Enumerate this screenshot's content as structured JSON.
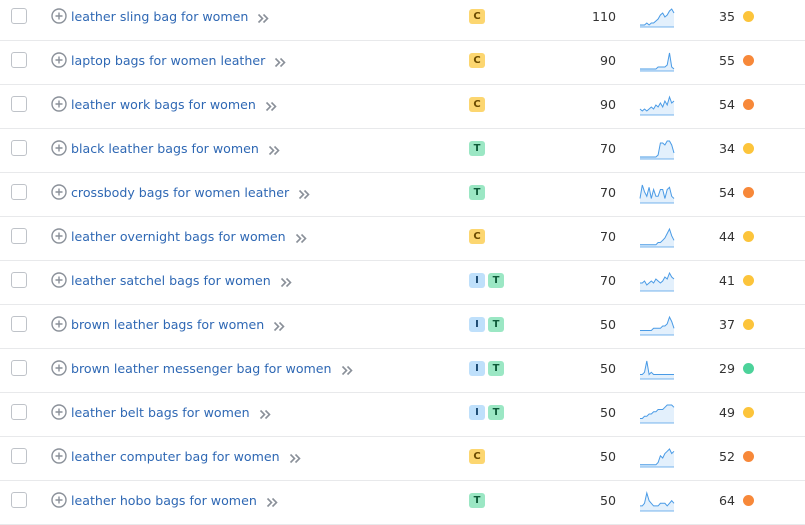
{
  "colors": {
    "link": "#2f68b4",
    "kd_easy": "#4cd29a",
    "kd_possible": "#fcc43b",
    "kd_difficult": "#f78839",
    "trend_line": "#4a9be6",
    "trend_fill": "#e3f0fc"
  },
  "rows": [
    {
      "keyword": "leather sling bag for women",
      "intents": [
        "C"
      ],
      "volume": "110",
      "trend": [
        1,
        1,
        1,
        2,
        1,
        2,
        2,
        3,
        4,
        6,
        7,
        5,
        6,
        8,
        9,
        7
      ],
      "kd": "35",
      "kd_level": "possible"
    },
    {
      "keyword": "laptop bags for women leather",
      "intents": [
        "C"
      ],
      "volume": "90",
      "trend": [
        1,
        1,
        1,
        1,
        1,
        1,
        1,
        1,
        2,
        2,
        2,
        2,
        3,
        9,
        2,
        1
      ],
      "kd": "55",
      "kd_level": "difficult"
    },
    {
      "keyword": "leather work bags for women",
      "intents": [
        "C"
      ],
      "volume": "90",
      "trend": [
        3,
        2,
        3,
        2,
        3,
        4,
        3,
        5,
        4,
        6,
        4,
        7,
        5,
        9,
        6,
        7
      ],
      "kd": "54",
      "kd_level": "difficult"
    },
    {
      "keyword": "black leather bags for women",
      "intents": [
        "T"
      ],
      "volume": "70",
      "trend": [
        1,
        1,
        1,
        1,
        1,
        1,
        1,
        1,
        2,
        8,
        8,
        7,
        9,
        9,
        7,
        3
      ],
      "kd": "34",
      "kd_level": "possible"
    },
    {
      "keyword": "crossbody bags for women leather",
      "intents": [
        "T"
      ],
      "volume": "70",
      "trend": [
        2,
        8,
        5,
        3,
        7,
        2,
        6,
        3,
        3,
        6,
        6,
        2,
        6,
        7,
        3,
        2
      ],
      "kd": "54",
      "kd_level": "difficult"
    },
    {
      "keyword": "leather overnight bags for women",
      "intents": [
        "C"
      ],
      "volume": "70",
      "trend": [
        1,
        1,
        1,
        1,
        1,
        1,
        1,
        1,
        2,
        2,
        3,
        4,
        6,
        8,
        5,
        3
      ],
      "kd": "44",
      "kd_level": "possible"
    },
    {
      "keyword": "leather satchel bags for women",
      "intents": [
        "I",
        "T"
      ],
      "volume": "70",
      "trend": [
        4,
        4,
        5,
        3,
        4,
        5,
        4,
        6,
        5,
        4,
        5,
        7,
        6,
        9,
        7,
        6
      ],
      "kd": "41",
      "kd_level": "possible"
    },
    {
      "keyword": "brown leather bags for women",
      "intents": [
        "I",
        "T"
      ],
      "volume": "50",
      "trend": [
        2,
        2,
        2,
        2,
        2,
        2,
        3,
        3,
        3,
        3,
        4,
        4,
        5,
        8,
        6,
        3
      ],
      "kd": "37",
      "kd_level": "possible"
    },
    {
      "keyword": "brown leather messenger bag for women",
      "intents": [
        "I",
        "T"
      ],
      "volume": "50",
      "trend": [
        2,
        2,
        3,
        8,
        2,
        3,
        2,
        2,
        2,
        2,
        2,
        2,
        2,
        2,
        2,
        2
      ],
      "kd": "29",
      "kd_level": "easy"
    },
    {
      "keyword": "leather belt bags for women",
      "intents": [
        "I",
        "T"
      ],
      "volume": "50",
      "trend": [
        2,
        2,
        3,
        3,
        4,
        4,
        5,
        5,
        6,
        6,
        6,
        7,
        8,
        8,
        8,
        7
      ],
      "kd": "49",
      "kd_level": "possible"
    },
    {
      "keyword": "leather computer bag for women",
      "intents": [
        "C"
      ],
      "volume": "50",
      "trend": [
        1,
        1,
        1,
        1,
        1,
        1,
        1,
        1,
        2,
        5,
        4,
        6,
        7,
        8,
        6,
        7
      ],
      "kd": "52",
      "kd_level": "difficult"
    },
    {
      "keyword": "leather hobo bags for women",
      "intents": [
        "T"
      ],
      "volume": "50",
      "trend": [
        2,
        2,
        3,
        7,
        4,
        3,
        2,
        2,
        2,
        3,
        3,
        3,
        2,
        3,
        4,
        3
      ],
      "kd": "64",
      "kd_level": "difficult"
    }
  ]
}
